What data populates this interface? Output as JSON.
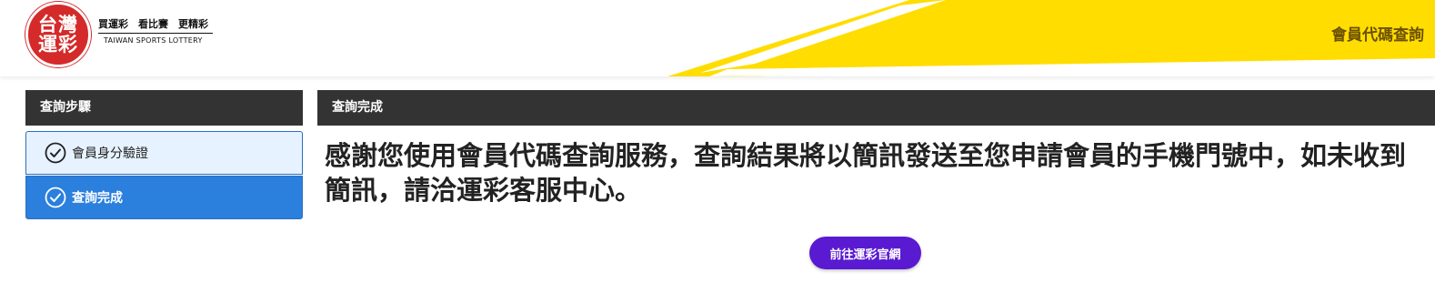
{
  "header": {
    "logo_line1": "台灣",
    "logo_line2": "運彩",
    "logo_slogan": "買運彩　看比賽　更精彩",
    "logo_english": "TAIWAN SPORTS LOTTERY",
    "page_title": "會員代碼查詢"
  },
  "sidebar": {
    "title": "查詢步驟",
    "steps": [
      {
        "label": "會員身分驗證",
        "state": "done"
      },
      {
        "label": "查詢完成",
        "state": "active"
      }
    ]
  },
  "main": {
    "title": "查詢完成",
    "message": "感謝您使用會員代碼查詢服務，查詢結果將以簡訊發送至您申請會員的手機門號中，如未收到簡訊，請洽運彩客服中心。",
    "button_label": "前往運彩官網"
  },
  "colors": {
    "accent_yellow": "#ffdd00",
    "brand_red": "#d42a2a",
    "header_bar": "#333333",
    "step_active": "#2b7fdd",
    "step_done_bg": "#e6f2ff",
    "button": "#5a1ad1"
  },
  "icons": {
    "step": "check-circle-icon"
  }
}
